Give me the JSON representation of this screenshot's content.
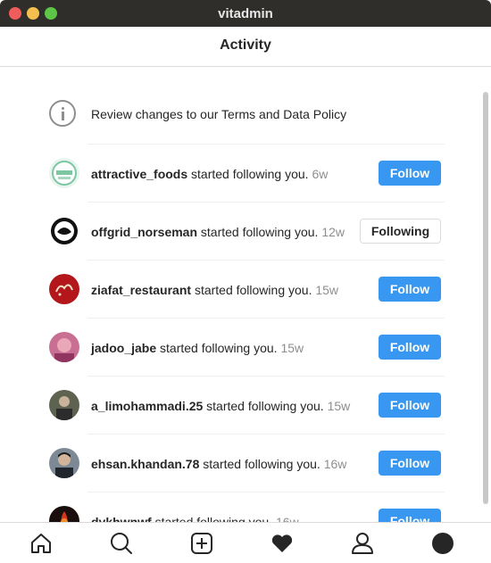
{
  "window": {
    "title": "vitadmin"
  },
  "header": {
    "title": "Activity"
  },
  "terms": {
    "text": "Review changes to our Terms and Data Policy"
  },
  "activities": [
    {
      "username": "attractive_foods",
      "action": "started following you.",
      "time": "6w",
      "button": "Follow",
      "avatar_color": "#e8f4ef"
    },
    {
      "username": "offgrid_norseman",
      "action": "started following you.",
      "time": "12w",
      "button": "Following",
      "avatar_color": "#ffffff"
    },
    {
      "username": "ziafat_restaurant",
      "action": "started following you.",
      "time": "15w",
      "button": "Follow",
      "avatar_color": "#b3171b"
    },
    {
      "username": "jadoo_jabe",
      "action": "started following you.",
      "time": "15w",
      "button": "Follow",
      "avatar_color": "#c86f93"
    },
    {
      "username": "a_limohammadi.25",
      "action": "started following you.",
      "time": "15w",
      "button": "Follow",
      "avatar_color": "#5d6350"
    },
    {
      "username": "ehsan.khandan.78",
      "action": "started following you.",
      "time": "16w",
      "button": "Follow",
      "avatar_color": "#7d8a96"
    },
    {
      "username": "dykhwnwf",
      "action": "started following you.",
      "time": "16w",
      "button": "Follow",
      "avatar_color": "#1a0f0c"
    }
  ],
  "colors": {
    "accent": "#3897f0",
    "muted": "#8e8e8e",
    "divider": "#efefef"
  },
  "nav": [
    "home-icon",
    "search-icon",
    "new-post-icon",
    "activity-heart-icon",
    "profile-icon",
    "account-avatar"
  ]
}
